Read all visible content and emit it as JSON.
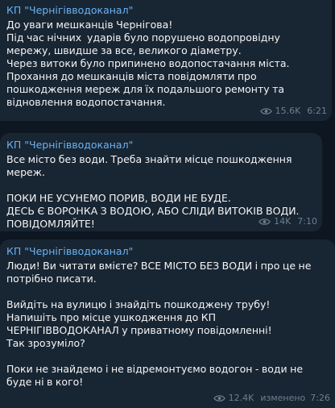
{
  "messages": [
    {
      "sender": "КП \"Чернігівводоканал\"",
      "text": "До уваги мешканців Чернігова!\nПід час нічних  ударів було порушено водопровідну мережу, швидше за все, великого діаметру.\nЧерез витоки було припинено водопостачання міста.\nПрохання до мешканців міста повідомляти про пошкодження мереж для їх подальшого ремонту та відновлення водопостачання.",
      "views": "15.6K",
      "edited": "",
      "time": "6:21"
    },
    {
      "sender": "КП \"Чернігівводоканал\"",
      "text": "Все місто без води. Треба знайти місце пошкодження мереж.\n\nПОКИ НЕ УСУНЕМО ПОРИВ, ВОДИ НЕ БУДЕ.\nДЕСЬ Є ВОРОНКА З ВОДОЮ, АБО СЛІДИ ВИТОКІВ ВОДИ. ПОВІДОМЛЯЙТЕ!",
      "views": "14K",
      "edited": "",
      "time": "7:10"
    },
    {
      "sender": "КП \"Чернігівводоканал\"",
      "text": "Люди! Ви читати вмієте? ВСЕ МІСТО БЕЗ ВОДИ і про це не потрібно писати.\n\nВийдіть на вулицю і знайдіть пошкоджену трубу!\nНапишіть про місце ушкодження до КП ЧЕРНІГІВВОДОКАНАЛ у приватному повідомленні!\nТак зрозуміло?\n\nПоки не знайдемо і не відремонтуємо водогон - води не буде ні в кого!",
      "views": "12.4K",
      "edited": "изменено",
      "time": "7:26"
    }
  ],
  "icons": {
    "views": "eye-icon"
  },
  "colors": {
    "background": "#0e1621",
    "bubble": "#182533",
    "sender": "#6ab3f3",
    "text": "#f5f5f5",
    "meta": "#6d7f8f"
  }
}
